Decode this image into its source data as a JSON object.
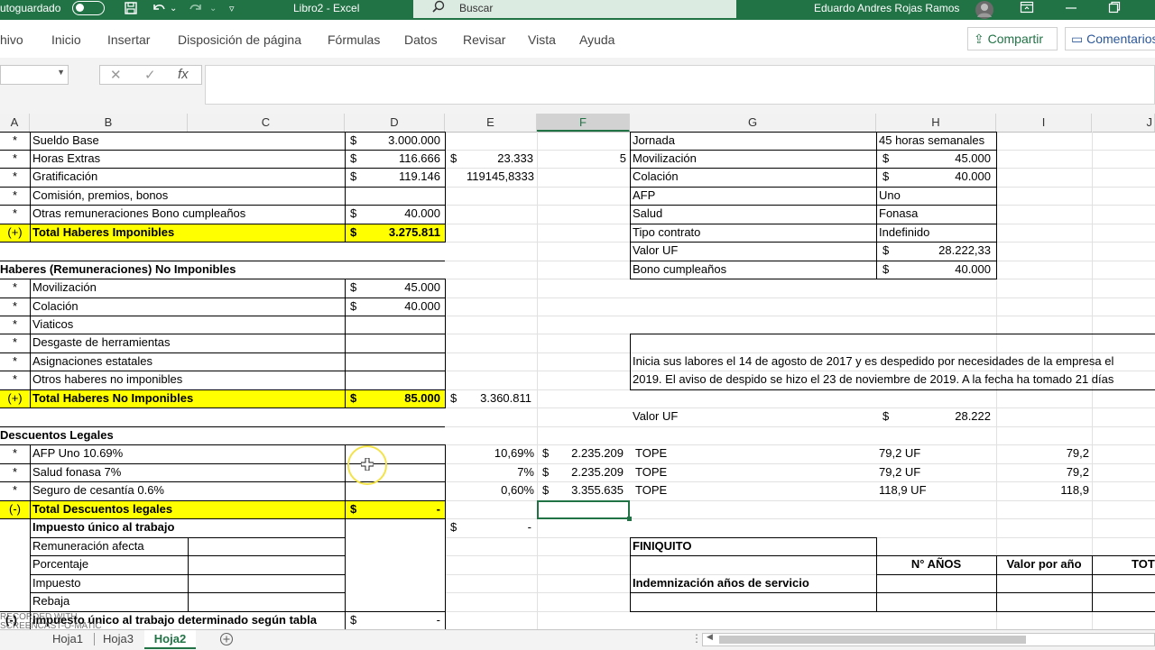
{
  "titlebar": {
    "autosave": "utoguardado",
    "doc_title": "Libro2  -  Excel",
    "search_placeholder": "Buscar",
    "user": "Eduardo Andres Rojas Ramos"
  },
  "ribbon": {
    "tabs": [
      "hivo",
      "Inicio",
      "Insertar",
      "Disposición de página",
      "Fórmulas",
      "Datos",
      "Revisar",
      "Vista",
      "Ayuda"
    ],
    "share": "Compartir",
    "comments": "Comentarios"
  },
  "formula_bar": {
    "fx": "fx",
    "cancel": "✕",
    "enter": "✓"
  },
  "columns": [
    "A",
    "B",
    "C",
    "D",
    "E",
    "F",
    "G",
    "H",
    "I",
    "J"
  ],
  "selected_column": "F",
  "cells": {
    "r1": {
      "a": "*",
      "b": "Sueldo Base",
      "d_sym": "$",
      "d": "3.000.000",
      "g": "Jornada",
      "h": "45 horas semanales"
    },
    "r2": {
      "a": "*",
      "b": "Horas Extras",
      "d_sym": "$",
      "d": "116.666",
      "e_sym": "$",
      "e": "23.333",
      "f": "5",
      "g": "Movilización",
      "h_sym": "$",
      "h": "45.000"
    },
    "r3": {
      "a": "*",
      "b": "Gratificación",
      "d_sym": "$",
      "d": "119.146",
      "e": "119145,8333",
      "g": "Colación",
      "h_sym": "$",
      "h": "40.000"
    },
    "r4": {
      "a": "*",
      "b": "Comisión, premios, bonos",
      "g": "AFP",
      "h": "Uno"
    },
    "r5": {
      "a": "*",
      "b": "Otras remuneraciones Bono cumpleaños",
      "d_sym": "$",
      "d": "40.000",
      "g": "Salud",
      "h": "Fonasa"
    },
    "r6": {
      "a": "(+)",
      "b": "Total Haberes Imponibles",
      "d_sym": "$",
      "d": "3.275.811",
      "g": "Tipo contrato",
      "h": "Indefinido"
    },
    "r7": {
      "g": "Valor UF",
      "h_sym": "$",
      "h": "28.222,33"
    },
    "r8": {
      "a": "Haberes (Remuneraciones) No Imponibles",
      "g": "Bono cumpleaños",
      "h_sym": "$",
      "h": "40.000"
    },
    "r9": {
      "a": "*",
      "b": "Movilización",
      "d_sym": "$",
      "d": "45.000"
    },
    "r10": {
      "a": "*",
      "b": "Colación",
      "d_sym": "$",
      "d": "40.000"
    },
    "r11": {
      "a": "*",
      "b": "Viaticos"
    },
    "r12": {
      "a": "*",
      "b": "Desgaste de herramientas"
    },
    "r13": {
      "a": "*",
      "b": "Asignaciones estatales",
      "g": "Inicia sus labores el 14 de agosto de 2017 y es despedido por necesidades de la empresa el"
    },
    "r14": {
      "a": "*",
      "b": "Otros haberes no imponibles",
      "g": "2019. El aviso de despido se hizo el 23 de noviembre de 2019. A la fecha ha tomado 21 días"
    },
    "r15": {
      "a": "(+)",
      "b": "Total Haberes No Imponibles",
      "d_sym": "$",
      "d": "85.000",
      "e_sym": "$",
      "e": "3.360.811"
    },
    "r16": {
      "g": "Valor UF",
      "h_sym": "$",
      "h": "28.222"
    },
    "r17": {
      "a": "Descuentos Legales"
    },
    "r18": {
      "a": "*",
      "b": "AFP Uno 10.69%",
      "e": "10,69%",
      "f_sym": "$",
      "f": "2.235.209",
      "g": "TOPE",
      "h": "79,2 UF",
      "i": "79,2"
    },
    "r19": {
      "a": "*",
      "b": "Salud fonasa 7%",
      "e": "7%",
      "f_sym": "$",
      "f": "2.235.209",
      "g": "TOPE",
      "h": "79,2 UF",
      "i": "79,2"
    },
    "r20": {
      "a": "*",
      "b": "Seguro de cesantía 0.6%",
      "e": "0,60%",
      "f_sym": "$",
      "f": "3.355.635",
      "g": "TOPE",
      "h": "118,9 UF",
      "i": "118,9"
    },
    "r21": {
      "a": "(-)",
      "b": "Total Descuentos legales",
      "d_sym": "$",
      "d": "-"
    },
    "r22": {
      "b": "Impuesto único al trabajo",
      "e_sym": "$",
      "e": "-"
    },
    "r23": {
      "b": "Remuneración afecta",
      "g": "FINIQUITO"
    },
    "r24": {
      "b": "Porcentaje",
      "h": "N° AÑOS",
      "i": "Valor por año",
      "j": "TOT"
    },
    "r25": {
      "b": "Impuesto",
      "g": "Indemnización años de servicio"
    },
    "r26": {
      "b": "Rebaja"
    },
    "r27": {
      "a": "(-)",
      "b": "Impuesto único al trabajo determinado según tabla",
      "d_sym": "$",
      "d": "-"
    }
  },
  "sheets": [
    "Hoja1",
    "Hoja3",
    "Hoja2"
  ],
  "active_sheet": "Hoja2",
  "watermark": "RECORDED WITH\nSCREENCAST-O-MATIC"
}
